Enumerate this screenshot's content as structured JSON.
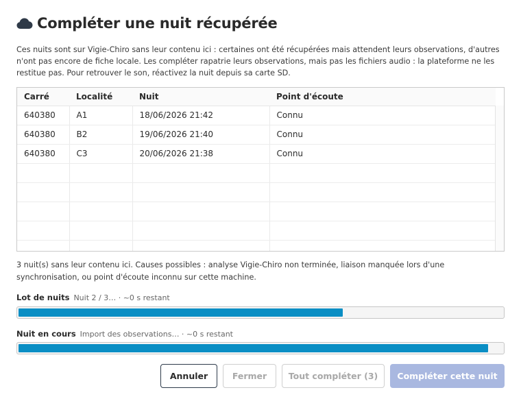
{
  "dialog": {
    "title": "Compléter une nuit récupérée",
    "icon": "cloud-icon",
    "intro": "Ces nuits sont sur Vigie-Chiro sans leur contenu ici : certaines ont été récupérées mais attendent leurs observations, d'autres n'ont pas encore de fiche locale. Les compléter rapatrie leurs observations, mais pas les fichiers audio : la plateforme ne les restitue pas. Pour retrouver le son, réactivez la nuit depuis sa carte SD."
  },
  "table": {
    "columns": [
      "Carré",
      "Localité",
      "Nuit",
      "Point d'écoute"
    ],
    "rows": [
      [
        "640380",
        "A1",
        "18/06/2026 21:42",
        "Connu"
      ],
      [
        "640380",
        "B2",
        "19/06/2026 21:40",
        "Connu"
      ],
      [
        "640380",
        "C3",
        "20/06/2026 21:38",
        "Connu"
      ]
    ]
  },
  "causes": "3 nuit(s) sans leur contenu ici. Causes possibles : analyse Vigie-Chiro non terminée, liaison manquée lors d'une synchronisation, ou point d'écoute inconnu sur cette machine.",
  "progress": {
    "batch": {
      "label": "Lot de nuits",
      "status": "Nuit 2 / 3… · ~0 s restant",
      "value": 0.67
    },
    "current": {
      "label": "Nuit en cours",
      "status": "Import des observations… · ~0 s restant",
      "value": 0.97
    }
  },
  "buttons": {
    "cancel": "Annuler",
    "close": "Fermer",
    "complete_all": "Tout compléter (3)",
    "complete_one": "Compléter cette nuit"
  },
  "colors": {
    "accent": "#0a8ec4",
    "primary_disabled": "#a9b8e0"
  }
}
